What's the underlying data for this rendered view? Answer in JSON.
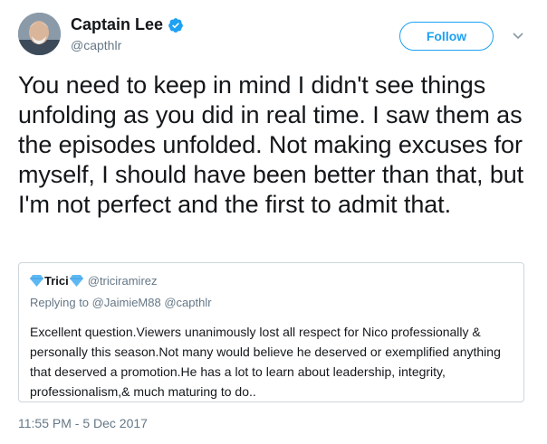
{
  "author": {
    "display_name": "Captain Lee",
    "handle": "@capthlr",
    "verified": true,
    "avatar_icon": "profile-photo"
  },
  "follow_button": {
    "label": "Follow"
  },
  "menu": {
    "icon": "chevron-down-icon"
  },
  "tweet": {
    "text": "You need to keep in mind I didn't see things unfolding as you did in real time. I saw them as the episodes unfolded. Not making excuses for myself, I should have been better than that, but I'm not perfect and the first to admit that."
  },
  "quoted_tweet": {
    "display_name": "Trici",
    "handle": "@triciramirez",
    "replying_prefix": "Replying to",
    "replying_to": "@JaimieM88 @capthlr",
    "text": "Excellent question.Viewers unanimously lost all respect for Nico professionally & personally this season.Not many would believe he deserved or exemplified anything that deserved a promotion.He has a lot to learn about leadership, integrity, professionalism,& much maturing to do.."
  },
  "timestamp": "11:55 PM - 5 Dec 2017",
  "colors": {
    "accent": "#1da1f2",
    "secondary_text": "#657786",
    "border": "#ccd6dd",
    "diamond": "#5eb8f2"
  }
}
